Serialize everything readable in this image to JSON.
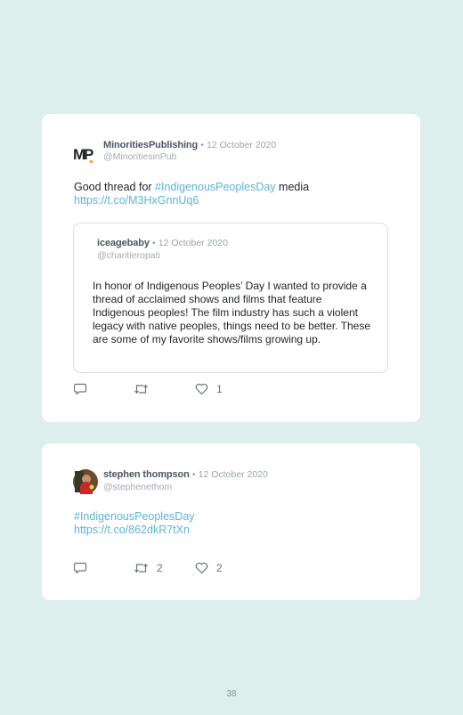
{
  "tweets": [
    {
      "display_name": "MinoritiesPublishing",
      "separator": "•",
      "date": "12 October 2020",
      "handle": "@MinoritiesinPub",
      "avatar_letters": "MP",
      "text_prefix": "Good thread for ",
      "hashtag": "#IndigenousPeoplesDay",
      "text_suffix": " media",
      "link": "https://t.co/M3HxGnnUq6",
      "quoted": {
        "display_name": "iceagebaby",
        "separator": "•",
        "date": "12 October 2020",
        "handle": "@charitieropati",
        "text": "In honor of Indigenous Peoples’ Day I wanted to provide a thread of acclaimed shows and films that feature Indigenous peoples! The film industry has such a violent legacy with native peoples, things need to be better. These are some of my favorite shows/films growing up."
      },
      "replies": "",
      "retweets": "",
      "likes": "1"
    },
    {
      "display_name": "stephen thompson",
      "separator": "•",
      "date": "12 October 2020",
      "handle": "@stephenethom",
      "hashtag": "#IndigenousPeoplesDay",
      "link": "https://t.co/862dkR7tXn",
      "replies": "",
      "retweets": "2",
      "likes": "2"
    }
  ],
  "page_number": "38",
  "colors": {
    "background": "#dcefed",
    "card": "#ffffff",
    "link": "#5bb4dc",
    "muted": "#9aa3ad"
  },
  "icons": [
    "reply-icon",
    "retweet-icon",
    "like-icon"
  ]
}
